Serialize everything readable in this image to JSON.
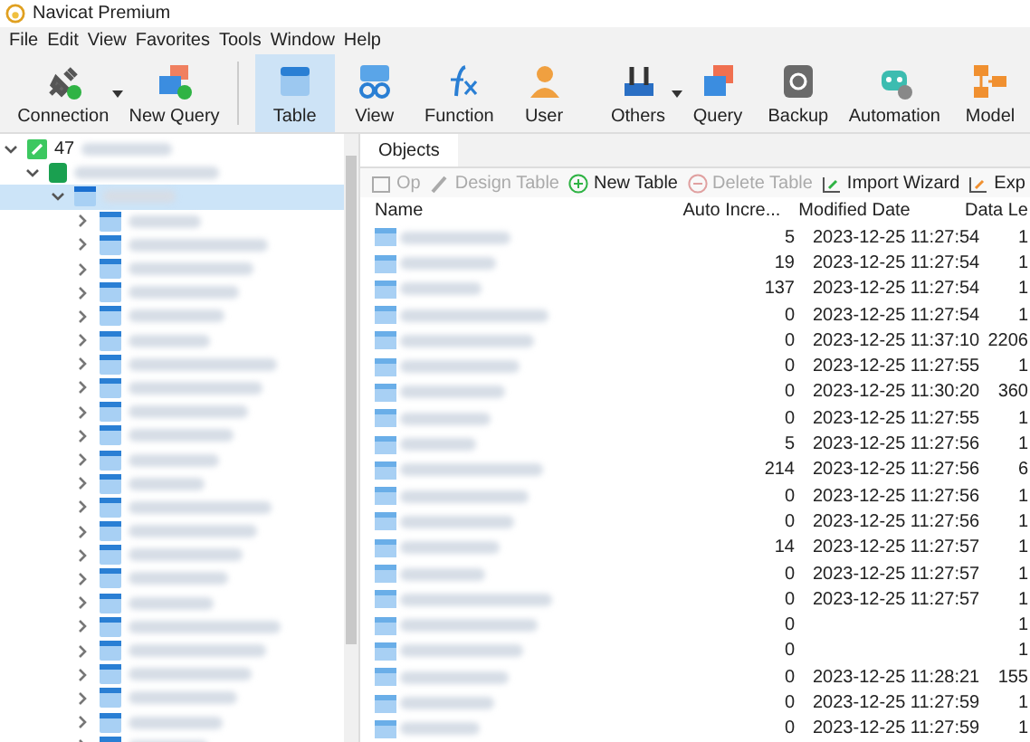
{
  "window": {
    "title": "Navicat Premium"
  },
  "menu": [
    "File",
    "Edit",
    "View",
    "Favorites",
    "Tools",
    "Window",
    "Help"
  ],
  "toolbar": [
    {
      "label": "Connection",
      "dropdown": true,
      "selected": false
    },
    {
      "label": "New Query",
      "dropdown": false,
      "selected": false
    },
    {
      "label": "Table",
      "dropdown": false,
      "selected": true
    },
    {
      "label": "View",
      "dropdown": false,
      "selected": false
    },
    {
      "label": "Function",
      "dropdown": false,
      "selected": false
    },
    {
      "label": "User",
      "dropdown": false,
      "selected": false
    },
    {
      "label": "Others",
      "dropdown": true,
      "selected": false
    },
    {
      "label": "Query",
      "dropdown": false,
      "selected": false
    },
    {
      "label": "Backup",
      "dropdown": false,
      "selected": false
    },
    {
      "label": "Automation",
      "dropdown": false,
      "selected": false
    },
    {
      "label": "Model",
      "dropdown": false,
      "selected": false
    }
  ],
  "sidebar": {
    "tree": [
      {
        "label": "47",
        "expanded": true,
        "children": [
          {
            "expanded": true,
            "children": [
              {
                "expanded": true,
                "selected": true,
                "children": [
                  {
                    "expanded": false
                  },
                  {
                    "expanded": false
                  },
                  {
                    "expanded": false
                  },
                  {
                    "expanded": false
                  },
                  {
                    "expanded": false
                  },
                  {
                    "expanded": false
                  },
                  {
                    "expanded": false
                  },
                  {
                    "expanded": false
                  },
                  {
                    "expanded": false
                  },
                  {
                    "expanded": false
                  },
                  {
                    "expanded": false
                  },
                  {
                    "expanded": false
                  },
                  {
                    "expanded": false
                  },
                  {
                    "expanded": false
                  },
                  {
                    "expanded": false
                  },
                  {
                    "expanded": false
                  },
                  {
                    "expanded": false
                  },
                  {
                    "expanded": false
                  },
                  {
                    "expanded": false
                  },
                  {
                    "expanded": false
                  },
                  {
                    "expanded": false
                  },
                  {
                    "expanded": false
                  },
                  {
                    "expanded": false
                  }
                ]
              }
            ]
          }
        ]
      }
    ]
  },
  "tabs": [
    {
      "label": "Objects",
      "selected": true
    }
  ],
  "actions": [
    {
      "label": "Op",
      "disabled": true
    },
    {
      "label": "Design Table",
      "disabled": true
    },
    {
      "label": "New Table",
      "disabled": false
    },
    {
      "label": "Delete Table",
      "disabled": true
    },
    {
      "label": "Import Wizard",
      "disabled": false
    },
    {
      "label": "Exp",
      "disabled": false
    }
  ],
  "table": {
    "columns": [
      "Name",
      "Auto Incre...",
      "Modified Date",
      "Data Le"
    ],
    "rows": [
      {
        "auto": "5",
        "modified": "2023-12-25 11:27:54",
        "data": "1"
      },
      {
        "auto": "19",
        "modified": "2023-12-25 11:27:54",
        "data": "1"
      },
      {
        "auto": "137",
        "modified": "2023-12-25 11:27:54",
        "data": "1"
      },
      {
        "auto": "0",
        "modified": "2023-12-25 11:27:54",
        "data": "1"
      },
      {
        "auto": "0",
        "modified": "2023-12-25 11:37:10",
        "data": "2206"
      },
      {
        "auto": "0",
        "modified": "2023-12-25 11:27:55",
        "data": "1"
      },
      {
        "auto": "0",
        "modified": "2023-12-25 11:30:20",
        "data": "360"
      },
      {
        "auto": "0",
        "modified": "2023-12-25 11:27:55",
        "data": "1"
      },
      {
        "auto": "5",
        "modified": "2023-12-25 11:27:56",
        "data": "1"
      },
      {
        "auto": "214",
        "modified": "2023-12-25 11:27:56",
        "data": "6"
      },
      {
        "auto": "0",
        "modified": "2023-12-25 11:27:56",
        "data": "1"
      },
      {
        "auto": "0",
        "modified": "2023-12-25 11:27:56",
        "data": "1"
      },
      {
        "auto": "14",
        "modified": "2023-12-25 11:27:57",
        "data": "1"
      },
      {
        "auto": "0",
        "modified": "2023-12-25 11:27:57",
        "data": "1"
      },
      {
        "auto": "0",
        "modified": "2023-12-25 11:27:57",
        "data": "1"
      },
      {
        "auto": "0",
        "data": "1"
      },
      {
        "auto": "0",
        "data": "1"
      },
      {
        "auto": "0",
        "modified": "2023-12-25 11:28:21",
        "data": "155"
      },
      {
        "auto": "0",
        "modified": "2023-12-25 11:27:59",
        "data": "1"
      },
      {
        "auto": "0",
        "modified": "2023-12-25 11:27:59",
        "data": "1"
      }
    ]
  }
}
